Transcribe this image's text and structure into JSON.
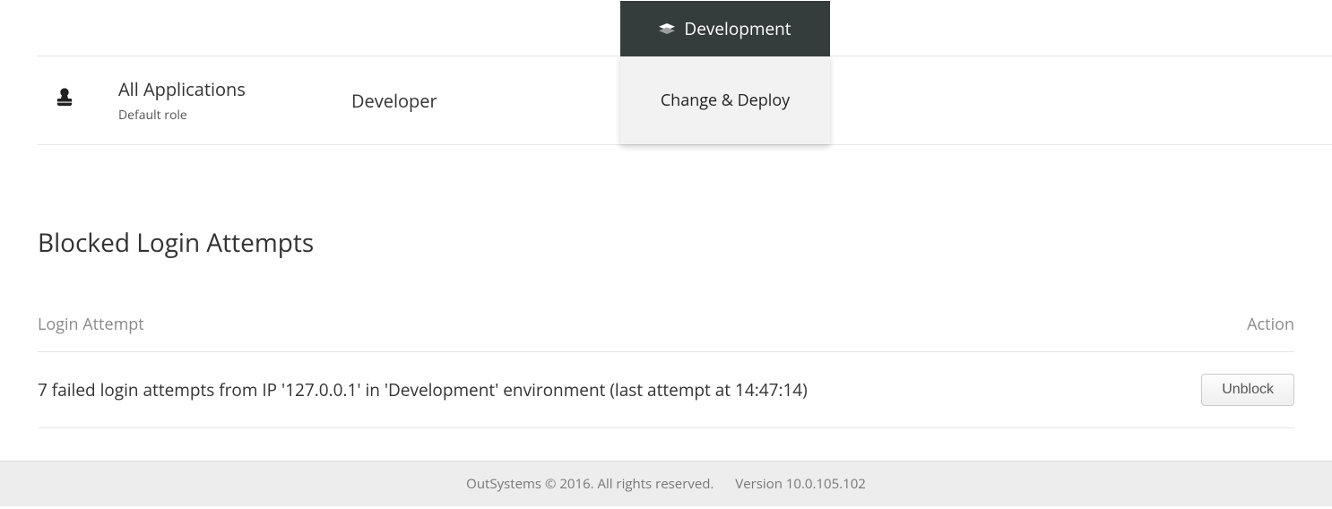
{
  "role_row": {
    "app_title": "All Applications",
    "app_subtitle": "Default role",
    "role_name": "Developer"
  },
  "env_panel": {
    "header": "Development",
    "body": "Change & Deploy"
  },
  "blocked": {
    "section_title": "Blocked Login Attempts",
    "col_attempt": "Login Attempt",
    "col_action": "Action",
    "rows": [
      {
        "text": "7 failed login attempts from IP '127.0.0.1' in 'Development' environment (last attempt at 14:47:14)",
        "action_label": "Unblock"
      }
    ]
  },
  "footer": {
    "copyright": "OutSystems © 2016. All rights reserved.",
    "version": "Version 10.0.105.102"
  }
}
